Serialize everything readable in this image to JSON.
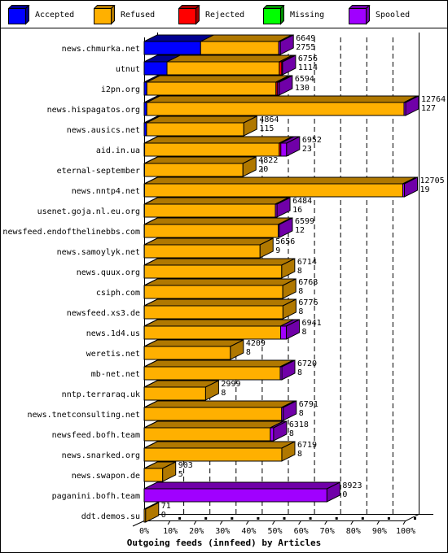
{
  "legend": [
    {
      "label": "Accepted",
      "color": "#0000ff",
      "dark": "#000090"
    },
    {
      "label": "Refused",
      "color": "#ffb000",
      "dark": "#b07800"
    },
    {
      "label": "Rejected",
      "color": "#ff0000",
      "dark": "#a00000"
    },
    {
      "label": "Missing",
      "color": "#00ff00",
      "dark": "#009000"
    },
    {
      "label": "Spooled",
      "color": "#a000ff",
      "dark": "#7000a8"
    }
  ],
  "chart_data": {
    "type": "bar",
    "orientation": "horizontal-stacked-3d",
    "title": "Outgoing feeds (innfeed) by Articles",
    "xlabel": "Outgoing feeds (innfeed) by Articles",
    "ylabel": "",
    "xlim": [
      0,
      100
    ],
    "x_unit": "%",
    "x_ticks": [
      "0%",
      "10%",
      "20%",
      "30%",
      "40%",
      "50%",
      "60%",
      "70%",
      "80%",
      "90%",
      "100%"
    ],
    "scale_max": 12764,
    "grid": true,
    "legend_position": "top",
    "categories": [
      "news.chmurka.net",
      "utnut",
      "i2pn.org",
      "news.hispagatos.org",
      "news.ausics.net",
      "aid.in.ua",
      "eternal-september",
      "news.nntp4.net",
      "usenet.goja.nl.eu.org",
      "newsfeed.endofthelinebbs.com",
      "news.samoylyk.net",
      "news.quux.org",
      "csiph.com",
      "newsfeed.xs3.de",
      "news.1d4.us",
      "weretis.net",
      "mb-net.net",
      "nntp.terraraq.uk",
      "news.tnetconsulting.net",
      "newsfeed.bofh.team",
      "news.snarked.org",
      "news.swapon.de",
      "paganini.bofh.team",
      "ddt.demos.su"
    ],
    "offered": [
      6649,
      6756,
      6594,
      12764,
      4864,
      6952,
      4822,
      12705,
      6484,
      6599,
      5656,
      6714,
      6768,
      6776,
      6941,
      4209,
      6720,
      2999,
      6791,
      6318,
      6719,
      903,
      8923,
      71
    ],
    "series": [
      {
        "name": "Accepted",
        "values": [
          2755,
          1114,
          130,
          127,
          115,
          23,
          20,
          19,
          16,
          12,
          9,
          8,
          8,
          8,
          8,
          8,
          8,
          8,
          8,
          8,
          8,
          5,
          0,
          0
        ]
      },
      {
        "name": "Refused",
        "values": [
          3814,
          5482,
          6304,
          12557,
          4749,
          6569,
          4802,
          12606,
          6388,
          6531,
          5647,
          6706,
          6760,
          6768,
          6653,
          4201,
          6632,
          2991,
          6703,
          6150,
          6711,
          898,
          0,
          71
        ]
      },
      {
        "name": "Rejected",
        "values": [
          0,
          120,
          80,
          0,
          0,
          80,
          0,
          0,
          0,
          0,
          0,
          0,
          0,
          0,
          0,
          0,
          0,
          0,
          0,
          0,
          0,
          0,
          0,
          0
        ]
      },
      {
        "name": "Missing",
        "values": [
          0,
          0,
          0,
          0,
          0,
          0,
          0,
          0,
          0,
          0,
          0,
          0,
          0,
          0,
          0,
          0,
          0,
          0,
          0,
          0,
          0,
          0,
          0,
          0
        ]
      },
      {
        "name": "Spooled",
        "values": [
          80,
          40,
          80,
          80,
          0,
          280,
          0,
          80,
          80,
          56,
          0,
          0,
          0,
          0,
          280,
          0,
          80,
          0,
          80,
          160,
          0,
          0,
          8923,
          0
        ]
      }
    ],
    "value_labels_top": [
      6649,
      6756,
      6594,
      12764,
      4864,
      6952,
      4822,
      12705,
      6484,
      6599,
      5656,
      6714,
      6768,
      6776,
      6941,
      4209,
      6720,
      2999,
      6791,
      6318,
      6719,
      903,
      8923,
      71
    ],
    "value_labels_bottom": [
      2755,
      1114,
      130,
      127,
      115,
      23,
      20,
      19,
      16,
      12,
      9,
      8,
      8,
      8,
      8,
      8,
      8,
      8,
      8,
      8,
      8,
      5,
      0,
      0
    ]
  }
}
